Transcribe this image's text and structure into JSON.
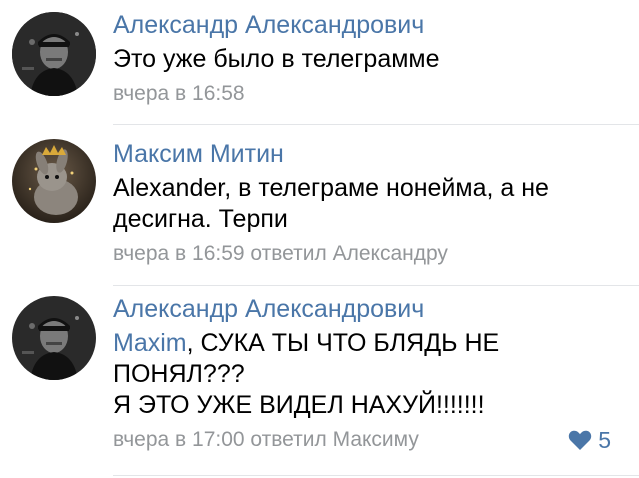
{
  "comments": [
    {
      "author": "Александр Александрович",
      "lines": [
        "Это уже было в телеграмме"
      ],
      "time": "вчера в 16:58",
      "reply_to": "",
      "likes": ""
    },
    {
      "author": "Максим Митин",
      "lines": [
        "Alexander, в телеграме нонейма, а не",
        "десигна. Терпи"
      ],
      "time": "вчера в 16:59",
      "reply_to": "ответил Александру",
      "likes": ""
    },
    {
      "author": "Александр Александрович",
      "mention": "Maxim",
      "line1_rest": ", СУКА ТЫ ЧТО БЛЯДЬ НЕ",
      "lines": [
        "ПОНЯЛ???",
        "Я ЭТО УЖЕ ВИДЕЛ НАХУЙ!!!!!!!"
      ],
      "time": "вчера в 17:00",
      "reply_to": "ответил Максиму",
      "likes": "5",
      "like_icon": "heart-icon"
    }
  ],
  "colors": {
    "author": "#4a76a8",
    "meta": "#939699",
    "like": "#4a76a8",
    "divider": "#e3e5e8"
  }
}
